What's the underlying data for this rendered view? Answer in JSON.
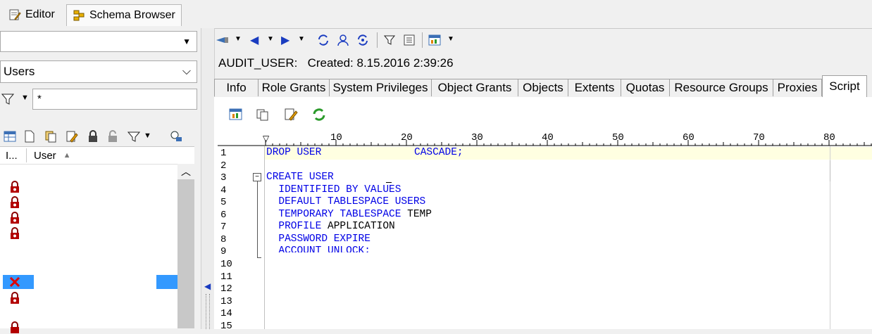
{
  "tabs_top": [
    {
      "label": "Editor",
      "icon": "editor-icon"
    },
    {
      "label": "Schema Browser",
      "icon": "schema-browser-icon"
    }
  ],
  "left": {
    "schema_combo": "",
    "object_type_combo": "Users",
    "filter_value": "*",
    "grid_headers": [
      "I...",
      "User"
    ]
  },
  "detail": {
    "title": "AUDIT_USER:   Created: 8.15.2016 2:39:26"
  },
  "detail_tabs": [
    "Info",
    "Role Grants",
    "System Privileges",
    "Object Grants",
    "Objects",
    "Extents",
    "Quotas",
    "Resource Groups",
    "Proxies",
    "Script"
  ],
  "ruler_labels": [
    "10",
    "20",
    "30",
    "40",
    "50",
    "60",
    "70",
    "80"
  ],
  "line_numbers": [
    "1",
    "2",
    "3",
    "4",
    "5",
    "6",
    "7",
    "8",
    "9",
    "10",
    "11",
    "12",
    "13",
    "14",
    "15"
  ],
  "script": {
    "l1a": "DROP USER",
    "l1b": "CASCADE;",
    "l3": "CREATE USER",
    "l4": "  IDENTIFIED BY VALUES",
    "l5": "  DEFAULT TABLESPACE USERS",
    "l6a": "  TEMPORARY TABLESPACE",
    "l6b": " TEMP",
    "l7a": "  PROFILE",
    "l7b": " APPLICATION",
    "l8": "  PASSWORD EXPIRE",
    "l9": "  ACCOUNT UNLOCK;"
  },
  "colors": {
    "keyword": "#0000e6",
    "highlight_line": "#ffffe1",
    "selection": "#3399ff"
  }
}
